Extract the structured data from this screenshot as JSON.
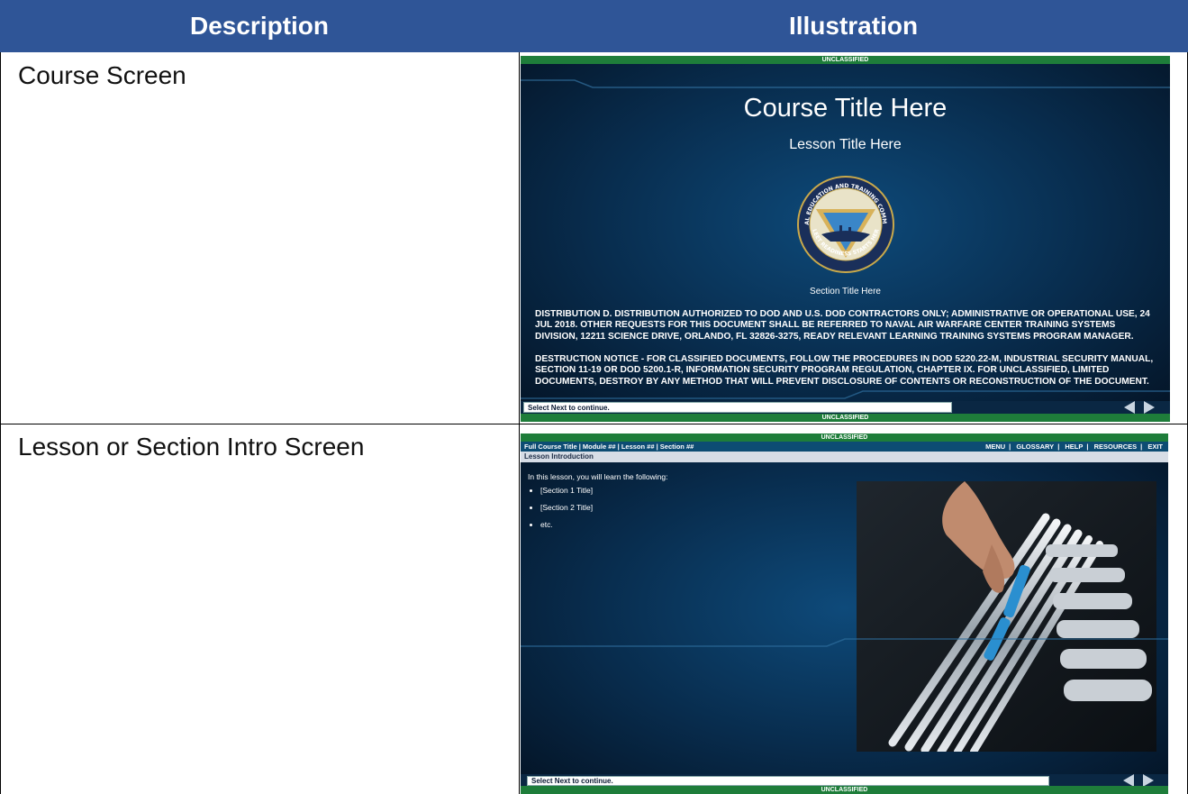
{
  "table": {
    "headers": {
      "description": "Description",
      "illustration": "Illustration"
    },
    "rows": [
      {
        "description": "Course Screen"
      },
      {
        "description": "Lesson or Section Intro Screen"
      }
    ]
  },
  "course_screen": {
    "classification_top": "UNCLASSIFIED",
    "classification_bottom": "UNCLASSIFIED",
    "course_title": "Course Title Here",
    "lesson_title": "Lesson Title Here",
    "seal": {
      "ring_top_text": "NAVAL EDUCATION AND TRAINING COMMAND",
      "ring_bottom_text": "FLEET READINESS STARTS HERE"
    },
    "section_title": "Section Title Here",
    "distribution_statement": "DISTRIBUTION D. DISTRIBUTION AUTHORIZED TO DOD AND U.S. DOD CONTRACTORS ONLY; ADMINISTRATIVE OR OPERATIONAL USE, 24 JUL 2018. OTHER REQUESTS FOR THIS DOCUMENT SHALL BE REFERRED TO NAVAL AIR WARFARE CENTER TRAINING SYSTEMS DIVISION, 12211 SCIENCE DRIVE, ORLANDO, FL 32826-3275, READY RELEVANT LEARNING TRAINING SYSTEMS PROGRAM MANAGER.",
    "destruction_notice": "DESTRUCTION NOTICE - FOR CLASSIFIED DOCUMENTS, FOLLOW THE PROCEDURES IN DOD 5220.22-M, INDUSTRIAL SECURITY MANUAL, SECTION 11-19 OR DOD 5200.1-R, INFORMATION SECURITY PROGRAM REGULATION, CHAPTER IX. FOR UNCLASSIFIED, LIMITED DOCUMENTS, DESTROY BY ANY METHOD THAT WILL PREVENT DISCLOSURE OF CONTENTS OR RECONSTRUCTION OF THE DOCUMENT.",
    "status_text": "Select Next to continue."
  },
  "intro_screen": {
    "classification_top": "UNCLASSIFIED",
    "classification_bottom": "UNCLASSIFIED",
    "breadcrumb": "Full Course Title | Module ## | Lesson ## | Section ##",
    "menu": [
      "MENU",
      "GLOSSARY",
      "HELP",
      "RESOURCES",
      "EXIT"
    ],
    "menu_separator": "|",
    "page_heading": "Lesson Introduction",
    "intro_sentence": "In this lesson, you will learn the following:",
    "bullets": [
      "[Section 1 Title]",
      "[Section 2 Title]",
      "etc."
    ],
    "status_text": "Select Next to continue."
  },
  "icons": [
    "prev-arrow-icon",
    "next-arrow-icon"
  ],
  "colors": {
    "header_blue": "#2f5597",
    "classification_green": "#1e7d3a",
    "screen_blue": "#082c4d"
  }
}
